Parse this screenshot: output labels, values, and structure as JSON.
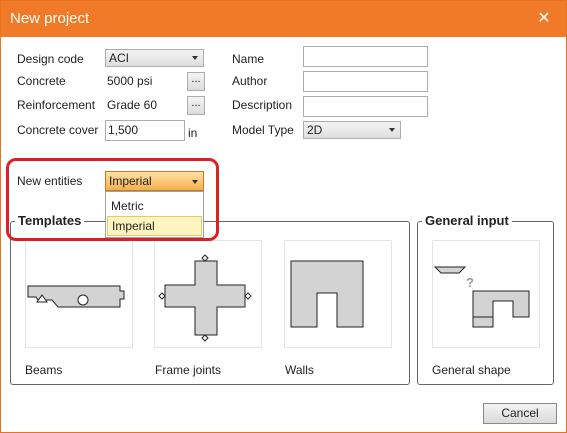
{
  "window": {
    "title": "New project"
  },
  "form": {
    "design_code_label": "Design code",
    "design_code_value": "ACI",
    "concrete_label": "Concrete",
    "concrete_value": "5000 psi",
    "reinforcement_label": "Reinforcement",
    "reinforcement_value": "Grade 60",
    "cover_label": "Concrete cover",
    "cover_value": "1,500",
    "cover_unit": "in",
    "name_label": "Name",
    "author_label": "Author",
    "description_label": "Description",
    "model_type_label": "Model Type",
    "model_type_value": "2D",
    "ellipsis": "...",
    "new_entities_label": "New entities",
    "new_entities_value": "Imperial",
    "new_entities_options": [
      "Metric",
      "Imperial"
    ]
  },
  "templates": {
    "title": "Templates",
    "items": [
      "Beams",
      "Frame joints",
      "Walls"
    ]
  },
  "general_input": {
    "title": "General input",
    "items": [
      "General shape"
    ]
  },
  "buttons": {
    "cancel": "Cancel"
  },
  "colors": {
    "titlebar": "#f07a28",
    "highlight": "#e02020",
    "shape_fill": "#d3d3d3"
  }
}
